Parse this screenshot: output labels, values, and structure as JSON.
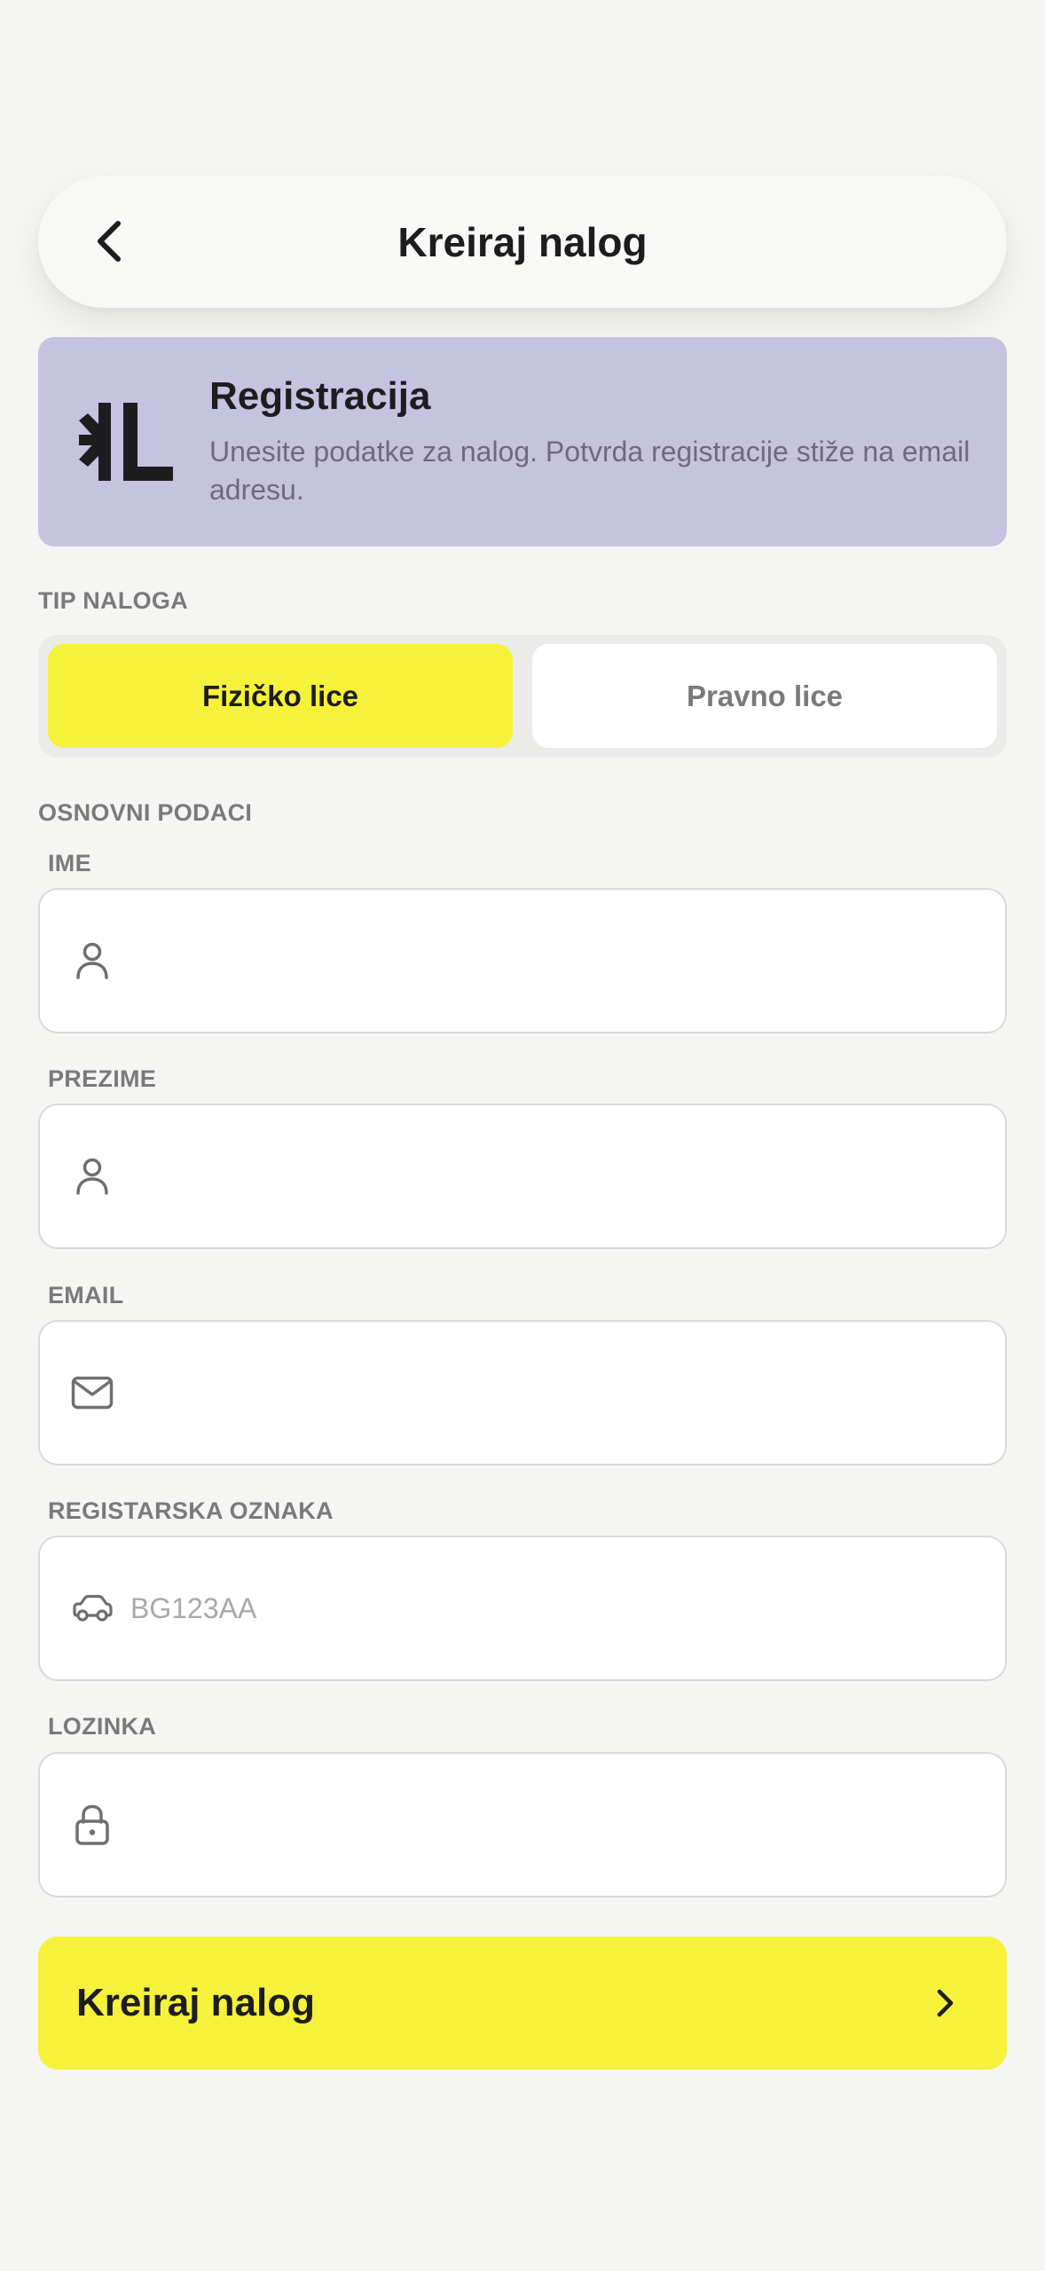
{
  "header": {
    "title": "Kreiraj nalog"
  },
  "banner": {
    "title": "Registracija",
    "text": "Unesite podatke za nalog. Potvrda registracije stiže na email adresu.",
    "background": "#c6c3e0",
    "logo_icon": "brand-logo-icon"
  },
  "account_type": {
    "section_label": "TIP NALOGA",
    "options": [
      {
        "label": "Fizičko lice",
        "selected": true
      },
      {
        "label": "Pravno lice",
        "selected": false
      }
    ]
  },
  "basic_info": {
    "section_label": "OSNOVNI PODACI",
    "fields": {
      "first_name": {
        "label": "IME",
        "value": "",
        "placeholder": "",
        "icon": "person-icon"
      },
      "last_name": {
        "label": "PREZIME",
        "value": "",
        "placeholder": "",
        "icon": "person-icon"
      },
      "email": {
        "label": "EMAIL",
        "value": "",
        "placeholder": "",
        "icon": "mail-icon"
      },
      "plate": {
        "label": "REGISTARSKA OZNAKA",
        "value": "",
        "placeholder": "BG123AA",
        "icon": "car-icon"
      },
      "password": {
        "label": "LOZINKA",
        "value": "",
        "placeholder": "",
        "icon": "lock-icon"
      }
    }
  },
  "submit": {
    "label": "Kreiraj nalog",
    "icon": "chevron-right-icon"
  },
  "colors": {
    "accent": "#f6f23b",
    "background": "#f5f5f3",
    "banner": "#c6c3e0"
  }
}
